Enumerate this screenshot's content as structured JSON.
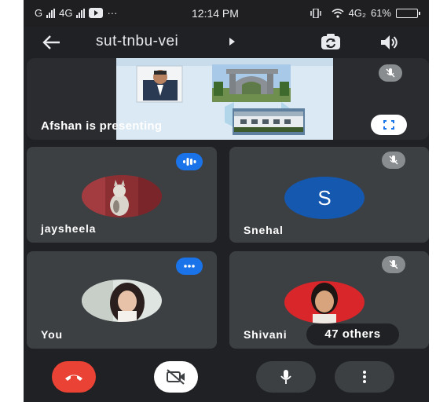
{
  "status_bar": {
    "carrier_text": "G",
    "network_left": "4G",
    "dots": "···",
    "time": "12:14 PM",
    "network_right": "4G₂",
    "battery": "61%"
  },
  "header": {
    "meeting_code": "sut-tnbu-vei"
  },
  "presenting_tile": {
    "label": "Afshan is presenting"
  },
  "participants": [
    {
      "name": "jaysheela"
    },
    {
      "name": "Snehal",
      "initial": "S",
      "avatar_color": "#1558b0"
    },
    {
      "name": "You"
    },
    {
      "name": "Shivani"
    }
  ],
  "others_count": "47 others",
  "colors": {
    "background": "#202124",
    "tile": "#3c4043",
    "accent_blue": "#1a73e8",
    "end_call_red": "#ea4335"
  },
  "icons": {
    "back": "arrow-left-icon",
    "camera_switch": "camera-switch-icon",
    "speaker": "speaker-icon",
    "mic_off": "mic-off-icon",
    "fullscreen": "fullscreen-icon",
    "speaking": "speaking-dots-icon",
    "end_call": "phone-hangup-icon",
    "camera_off": "camera-off-icon",
    "mic": "mic-icon",
    "more": "more-vertical-icon"
  }
}
